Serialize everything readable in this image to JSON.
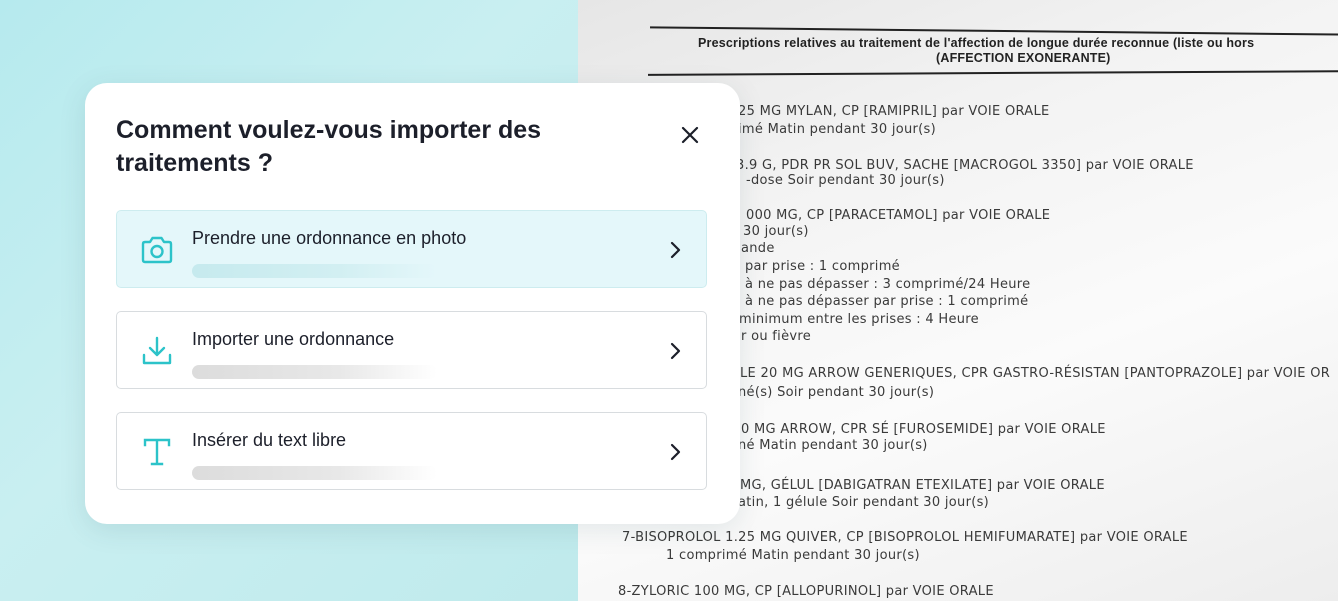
{
  "modal": {
    "title": "Comment voulez-vous importer des traitements ?",
    "options": [
      {
        "label": "Prendre une ordonnance en photo",
        "icon": "camera-icon"
      },
      {
        "label": "Importer une ordonnance",
        "icon": "download-icon"
      },
      {
        "label": "Insérer du text libre",
        "icon": "text-icon"
      }
    ]
  },
  "prescription": {
    "header_line1": "Prescriptions relatives au traitement de l'affection de longue durée reconnue (liste ou hors",
    "header_line2": "(AFFECTION EXONERANTE)",
    "lines": [
      "25 MG MYLAN, CP [RAMIPRIL] par VOIE ORALE",
      "imé Matin pendant 30 jour(s)",
      "3.9 G, PDR PR SOL BUV, SACHE [MACROGOL 3350] par VOIE ORALE",
      "-dose Soir pendant 30 jour(s)",
      "000 MG, CP [PARACETAMOL] par VOIE ORALE",
      "30 jour(s)",
      "ande",
      "par prise : 1 comprimé",
      "à ne pas dépasser : 3 comprimé/24 Heure",
      "à ne pas dépasser par prise : 1 comprimé",
      "minimum entre les prises : 4 Heure",
      "r ou fièvre",
      "LE 20 MG ARROW GENERIQUES, CPR GASTRO-RÉSISTAN [PANTOPRAZOLE] par VOIE OR",
      "né(s) Soir pendant 30 jour(s)",
      "0 MG ARROW, CPR SÉ [FUROSEMIDE] par VOIE ORALE",
      "né Matin pendant 30 jour(s)",
      "MG, GÉLUL [DABIGATRAN ETEXILATE] par VOIE ORALE",
      "atin, 1 gélule Soir pendant 30 jour(s)",
      "7-BISOPROLOL 1.25 MG QUIVER, CP [BISOPROLOL HEMIFUMARATE] par VOIE ORALE",
      "1 comprimé Matin pendant 30 jour(s)",
      "8-ZYLORIC 100 MG, CP [ALLOPURINOL] par VOIE ORALE"
    ]
  },
  "colors": {
    "accent": "#2cc3c9",
    "title": "#1c1f2a",
    "active_option_bg": "#e4f7fa",
    "page_bg": "#c8eef0"
  }
}
